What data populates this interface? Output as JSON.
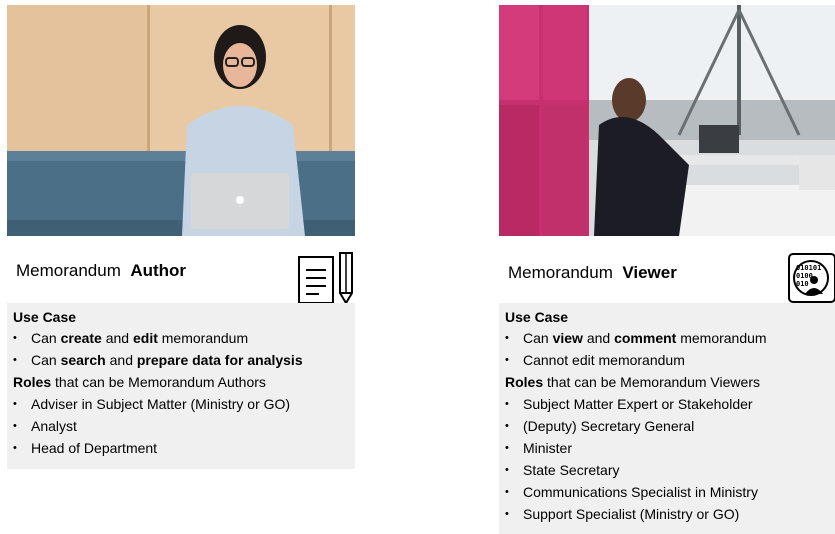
{
  "author": {
    "title_prefix": "Memorandum",
    "title_bold": "Author",
    "use_case_heading": "Use Case",
    "use_cases": [
      {
        "a": "Can ",
        "b": "create",
        "c": " and ",
        "d": "edit",
        "e": " memorandum"
      },
      {
        "a": "Can ",
        "b": "search",
        "c": " and ",
        "d": "prepare data for analysis",
        "e": ""
      }
    ],
    "roles_bold": "Roles",
    "roles_rest": " that can be Memorandum Authors",
    "roles": [
      "Adviser in Subject Matter (Ministry or GO)",
      "Analyst",
      "Head of Department"
    ],
    "icon": "document-pencil-icon"
  },
  "viewer": {
    "title_prefix": "Memorandum",
    "title_bold": "Viewer",
    "use_case_heading": "Use Case",
    "use_cases": [
      {
        "a": "Can ",
        "b": "view",
        "c": " and ",
        "d": "comment",
        "e": " memorandum"
      },
      {
        "a": "Cannot edit memorandum",
        "b": "",
        "c": "",
        "d": "",
        "e": ""
      }
    ],
    "roles_bold": "Roles",
    "roles_rest": " that can be Memorandum Viewers",
    "roles": [
      "Subject Matter Expert or Stakeholder",
      "(Deputy) Secretary General",
      "Minister",
      "State Secretary",
      "Communications Specialist in Ministry",
      "Support Specialist (Ministry or GO)"
    ],
    "icon": "binary-person-icon"
  }
}
